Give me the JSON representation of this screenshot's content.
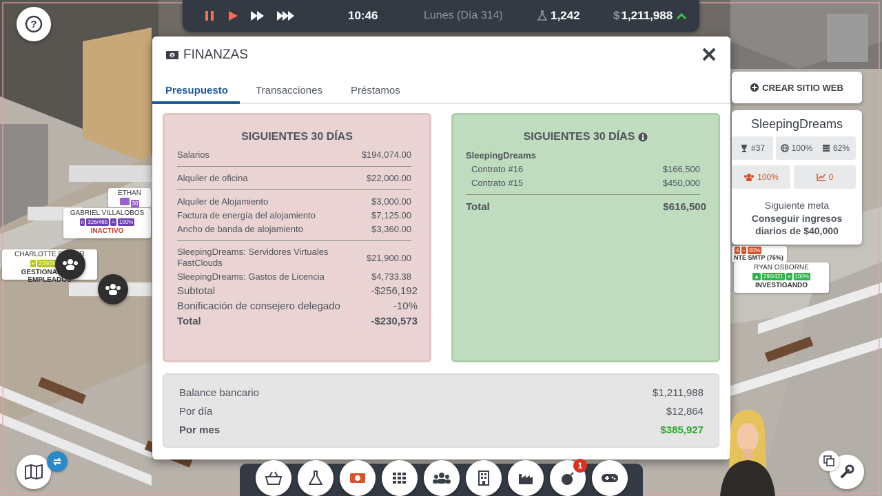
{
  "topbar": {
    "time": "10:46",
    "day": "Lunes (Día 314)",
    "research": "1,242",
    "money": "1,211,988",
    "currency_symbol": "$"
  },
  "modal": {
    "title": "FINANZAS",
    "tabs": [
      "Presupuesto",
      "Transacciones",
      "Préstamos"
    ],
    "active_tab": "Presupuesto"
  },
  "expenses": {
    "heading": "SIGUIENTES 30 DÍAS",
    "salaries": {
      "label": "Salarios",
      "value": "$194,074.00"
    },
    "office": {
      "label": "Alquiler de oficina",
      "value": "$22,000.00"
    },
    "hosting": [
      {
        "label": "Alquiler de Alojamiento",
        "value": "$3,000.00"
      },
      {
        "label": "Factura de energía del alojamiento",
        "value": "$7,125.00"
      },
      {
        "label": "Ancho de banda de alojamiento",
        "value": "$3,360.00"
      }
    ],
    "product": [
      {
        "label": "SleepingDreams: Servidores Virtuales FastClouds",
        "value": "$21,900.00"
      },
      {
        "label": "SleepingDreams: Gastos de Licencia",
        "value": "$4,733.38"
      }
    ],
    "subtotal": {
      "label": "Subtotal",
      "value": "-$256,192"
    },
    "bonus": {
      "label": "Bonificación de consejero delegado",
      "value": "-10%"
    },
    "total": {
      "label": "Total",
      "value": "-$230,573"
    }
  },
  "income": {
    "heading": "SIGUIENTES 30 DÍAS",
    "product": "SleepingDreams",
    "contracts": [
      {
        "label": "Contrato #16",
        "value": "$166,500"
      },
      {
        "label": "Contrato #15",
        "value": "$450,000"
      }
    ],
    "total": {
      "label": "Total",
      "value": "$616,500"
    }
  },
  "summary": {
    "balance": {
      "label": "Balance bancario",
      "value": "$1,211,988"
    },
    "per_day": {
      "label": "Por día",
      "value": "$12,864"
    },
    "per_month": {
      "label": "Por mes",
      "value": "$385,927"
    }
  },
  "sidepanel": {
    "create_button": "CREAR SITIO WEB",
    "product_name": "SleepingDreams",
    "rank": "#37",
    "stability": "100%",
    "storage": "62%",
    "users_pct": "100%",
    "trend": "0",
    "goal_label": "Siguiente meta",
    "goal_text": "Conseguir ingresos diarios de $40,000"
  },
  "employees": [
    {
      "name": "ETHAN",
      "status": ""
    },
    {
      "name": "GABRIEL VILLALOBOS",
      "stat": "326/465",
      "pct": "100%",
      "status": "INACTIVO"
    },
    {
      "name": "CHARLOTTE FULLER",
      "stat": "229/396",
      "status": "GESTIONANDO 8 EMPLEADOS"
    },
    {
      "name": "RYAN OSBORNE",
      "stat": "296/421",
      "pct": "100%",
      "status": "INVESTIGANDO"
    },
    {
      "name": "NTE SMTP (76%)",
      "status": ""
    }
  ],
  "notifications": {
    "badge": "1"
  },
  "colors": {
    "accent": "#1d5c9c",
    "positive": "#2ea62e",
    "expense_panel": "#ead4d3",
    "income_panel": "#bfdcbf",
    "bar": "#333a44"
  }
}
